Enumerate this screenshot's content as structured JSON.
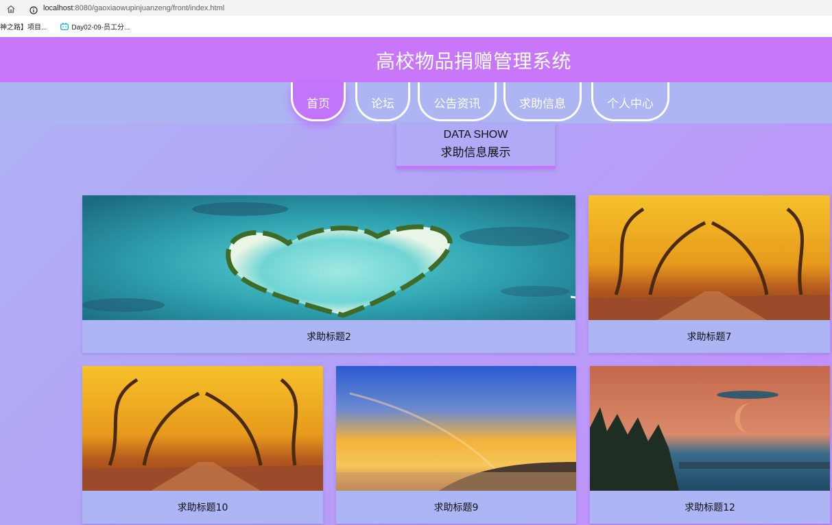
{
  "browser": {
    "url_host": "localhost",
    "url_path": ":8080/gaoxiaowupinjuanzeng/front/index.html",
    "bookmarks": [
      "神之路】项目...",
      "Day02-09-员工分..."
    ]
  },
  "header": {
    "title": "高校物品捐赠管理系统"
  },
  "nav": {
    "items": [
      {
        "label": "首页"
      },
      {
        "label": "论坛"
      },
      {
        "label": "公告资讯"
      },
      {
        "label": "求助信息"
      },
      {
        "label": "个人中心"
      }
    ]
  },
  "section": {
    "en": "DATA SHOW",
    "zh": "求助信息展示"
  },
  "cards": [
    {
      "caption": "求助标题2",
      "image": "heart-island"
    },
    {
      "caption": "求助标题7",
      "image": "autumn-trees"
    },
    {
      "caption": "求助标题10",
      "image": "autumn-trees"
    },
    {
      "caption": "求助标题9",
      "image": "sunset-rainbow-sea"
    },
    {
      "caption": "求助标题12",
      "image": "moon-lake-forest"
    }
  ],
  "colors": {
    "header": "#c877fb",
    "navband": "#adb5f2",
    "card": "#adb5f4",
    "accent": "#c872fb"
  }
}
